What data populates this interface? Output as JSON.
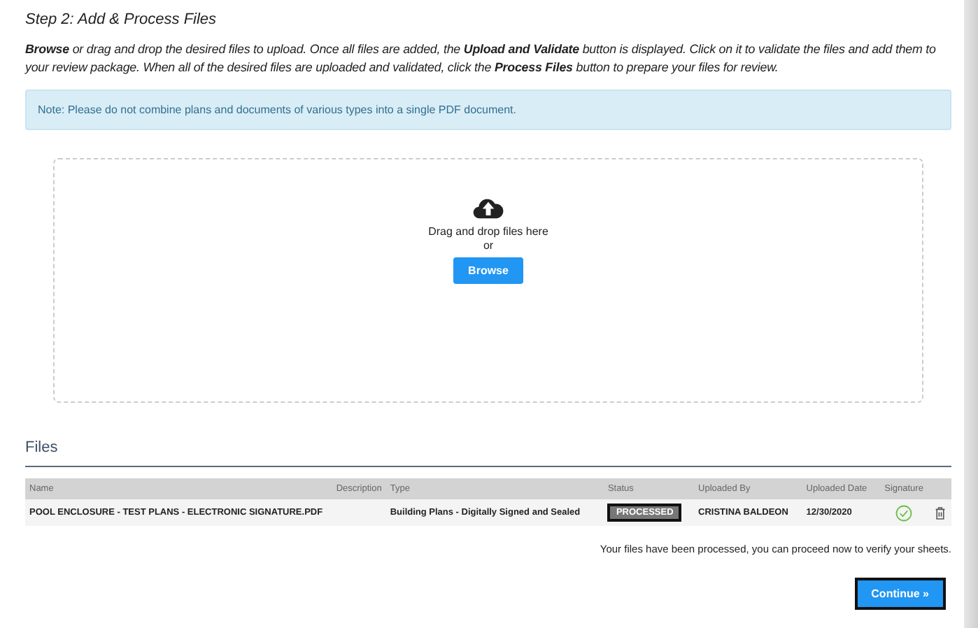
{
  "step_title": "Step 2: Add & Process Files",
  "instructions": "**Browse** or drag and drop the desired files to upload. Once all files are added, the **Upload and Validate** button is displayed. Click on it to validate the files and add them to your review package. When all of the desired files are uploaded and validated, click the **Process Files** button to prepare your files for review.",
  "note": "Note: Please do not combine plans and documents of various types into a single PDF document.",
  "dropzone": {
    "prompt": "Drag and drop files here",
    "separator": "or",
    "button": "Browse"
  },
  "files_heading": "Files",
  "table": {
    "columns": [
      "Name",
      "Description",
      "Type",
      "Status",
      "Uploaded By",
      "Uploaded Date",
      "Signature"
    ],
    "rows": [
      {
        "name": "POOL ENCLOSURE - TEST PLANS - ELECTRONIC SIGNATURE.PDF",
        "type": "Building Plans - Digitally Signed and Sealed",
        "status": "PROCESSED",
        "uploaded_by": "CRISTINA BALDEON",
        "uploaded_date": "12/30/2020",
        "signed": true
      }
    ]
  },
  "message": "Your files have been processed, you can proceed now to verify your sheets.",
  "continue_button": "Continue »"
}
